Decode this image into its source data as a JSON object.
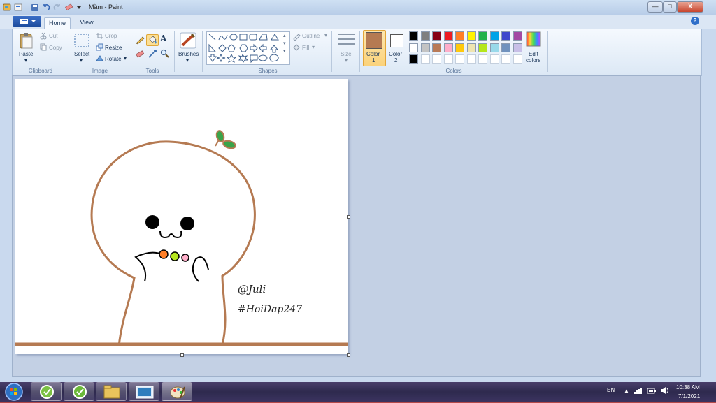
{
  "window": {
    "title": "Mầm - Paint"
  },
  "tabs": [
    {
      "label": "Home"
    },
    {
      "label": "View"
    }
  ],
  "clipboard": {
    "group": "Clipboard",
    "paste": "Paste",
    "cut": "Cut",
    "copy": "Copy"
  },
  "image": {
    "group": "Image",
    "select": "Select",
    "crop": "Crop",
    "resize": "Resize",
    "rotate": "Rotate"
  },
  "tools": {
    "group": "Tools",
    "text_tool_glyph": "A"
  },
  "brushes": {
    "label": "Brushes"
  },
  "shapes": {
    "group": "Shapes",
    "outline": "Outline",
    "fill": "Fill"
  },
  "size": {
    "label": "Size"
  },
  "color1": {
    "label": "Color",
    "num": "1",
    "value": "#b57a52"
  },
  "color2": {
    "label": "Color",
    "num": "2",
    "value": "#ffffff"
  },
  "colors": {
    "group": "Colors",
    "row1": [
      "#000000",
      "#7f7f7f",
      "#880015",
      "#ed1c24",
      "#ff7f27",
      "#fff200",
      "#22b14c",
      "#00a2e8",
      "#3f48cc",
      "#a349a4"
    ],
    "row2": [
      "#ffffff",
      "#c3c3c3",
      "#b97a57",
      "#ffaec9",
      "#ffc90e",
      "#efe4b0",
      "#b5e61d",
      "#99d9ea",
      "#7092be",
      "#c8bfe7"
    ],
    "row3": [
      "#000000",
      "#ffffff",
      "#ffffff",
      "#ffffff",
      "#ffffff",
      "#ffffff",
      "#ffffff",
      "#ffffff",
      "#ffffff",
      "#ffffff"
    ],
    "edit_label": "Edit",
    "edit_label2": "colors"
  },
  "drawing": {
    "watermark1": "@Juli",
    "watermark2": "#HoiDap247"
  },
  "tray": {
    "lang": "EN",
    "time": "10:38 AM",
    "date": "7/1/2021"
  },
  "window_controls": {
    "minimize": "—",
    "maximize": "□",
    "close": "X"
  },
  "help": "?"
}
